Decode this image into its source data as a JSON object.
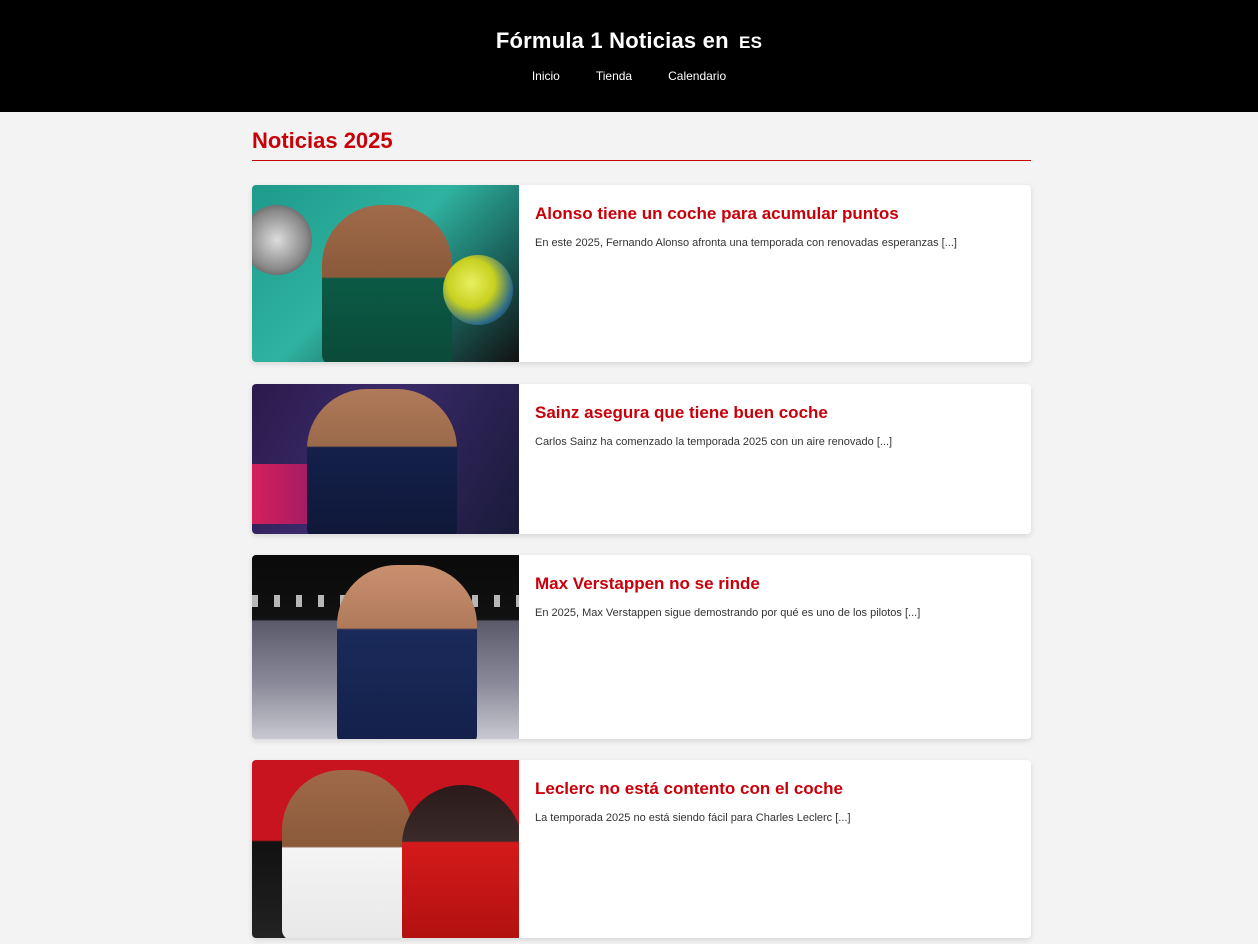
{
  "header": {
    "title": "Fórmula 1 Noticias en",
    "lang_badge": "ES",
    "nav": [
      "Inicio",
      "Tienda",
      "Calendario"
    ]
  },
  "main": {
    "section_title": "Noticias 2025",
    "articles": [
      {
        "title": "Alonso tiene un coche para acumular puntos",
        "excerpt": "En este 2025, Fernando Alonso afronta una temporada con renovadas esperanzas [...]"
      },
      {
        "title": "Sainz asegura que tiene buen coche",
        "excerpt": "Carlos Sainz ha comenzado la temporada 2025 con un aire renovado [...]"
      },
      {
        "title": "Max Verstappen no se rinde",
        "excerpt": "En 2025, Max Verstappen sigue demostrando por qué es uno de los pilotos [...]"
      },
      {
        "title": "Leclerc no está contento con el coche",
        "excerpt": "La temporada 2025 no está siendo fácil para Charles Leclerc [...]"
      }
    ]
  },
  "colors": {
    "accent": "#c8000a",
    "header_bg": "#000000",
    "page_bg": "#f3f3f3"
  }
}
